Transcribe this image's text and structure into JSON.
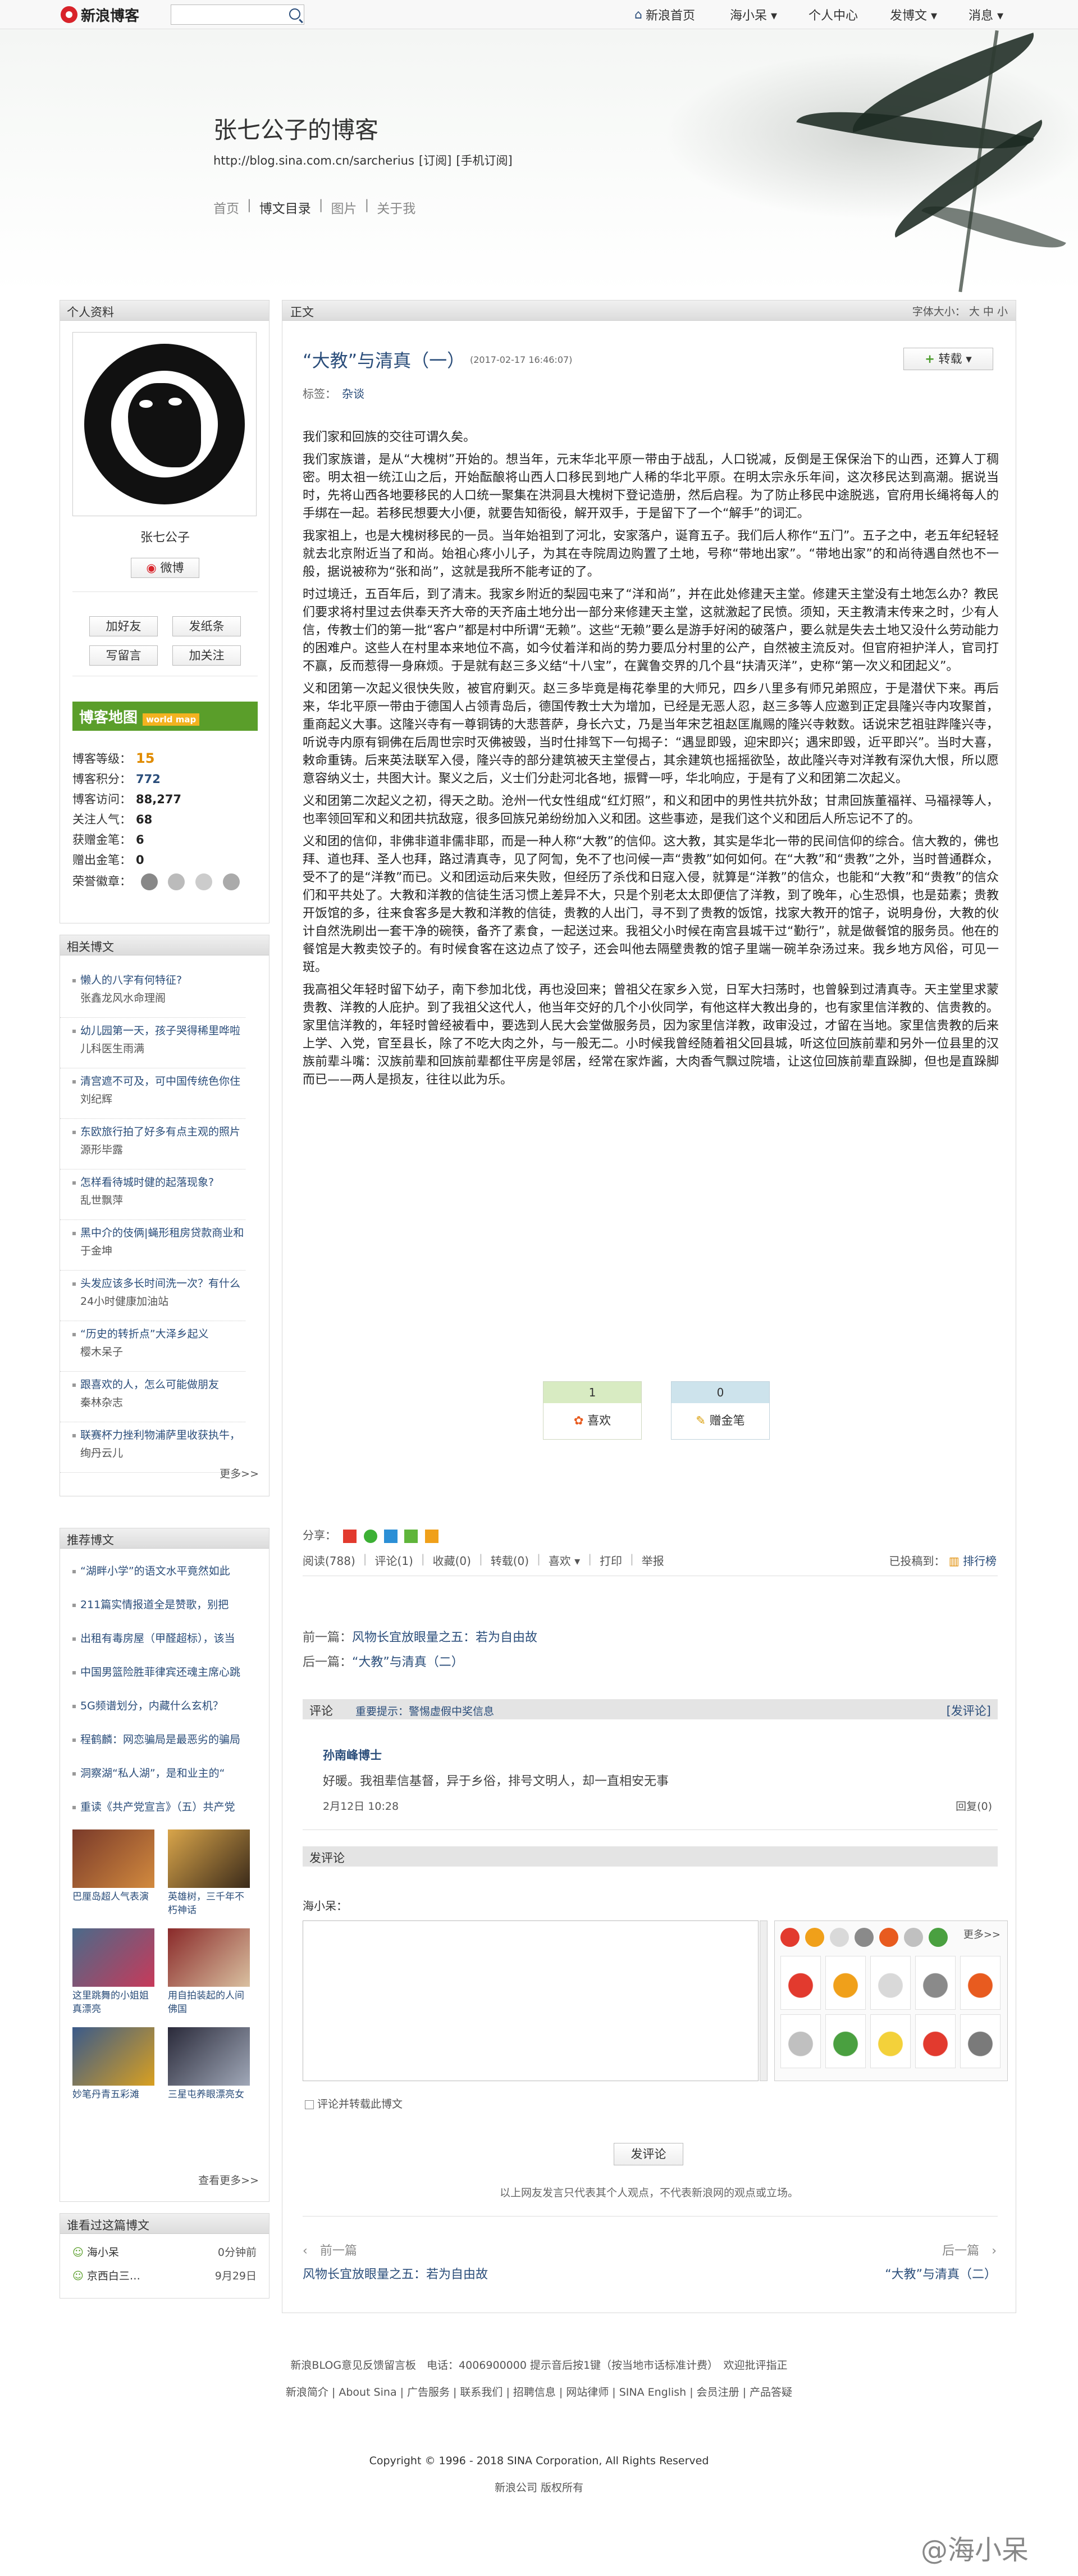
{
  "topbar": {
    "brand": "新浪博客",
    "search_placeholder": "",
    "nav": [
      "新浪首页",
      "海小呆 ▾",
      "个人中心",
      "发博文 ▾",
      "消息 ▾"
    ]
  },
  "header": {
    "title": "张七公子的博客",
    "url": "http://blog.sina.com.cn/sarcherius",
    "subscribe": "[订阅]",
    "mobile": "[手机订阅]",
    "nav": [
      "首页",
      "博文目录",
      "图片",
      "关于我"
    ]
  },
  "profile": {
    "heading": "个人资料",
    "name": "张七公子",
    "weibo": "微博",
    "buttons": [
      "加好友",
      "发纸条",
      "写留言",
      "加关注"
    ],
    "blogmap": "博客地图",
    "blogmap_sub": "world map",
    "stats": [
      {
        "label": "博客等级：",
        "value": "15"
      },
      {
        "label": "博客积分：",
        "value": "772"
      },
      {
        "label": "博客访问：",
        "value": "88,277"
      },
      {
        "label": "关注人气：",
        "value": "68"
      },
      {
        "label": "获赠金笔：",
        "value": "6"
      },
      {
        "label": "赠出金笔：",
        "value": "0"
      },
      {
        "label": "荣誉徽章：",
        "value": ""
      }
    ]
  },
  "related": {
    "heading": "相关博文",
    "more": "更多>>",
    "items": [
      {
        "t": "懒人的八字有何特征?",
        "s": "张鑫龙风水命理阁"
      },
      {
        "t": "幼儿园第一天，孩子哭得稀里哗啦",
        "s": "儿科医生雨满"
      },
      {
        "t": "清宫遮不可及，可中国传统色你住",
        "s": "刘纪辉"
      },
      {
        "t": "东欧旅行拍了好多有点主观的照片",
        "s": "源形毕露"
      },
      {
        "t": "怎样看待城时健的起落现象?",
        "s": "乱世飘萍"
      },
      {
        "t": "黑中介的伎俩|蝇形租房贷款商业和",
        "s": "于金坤"
      },
      {
        "t": "头发应该多长时间洗一次？有什么",
        "s": "24小时健康加油站"
      },
      {
        "t": "“历史的转折点”大泽乡起义",
        "s": "樱木呆子"
      },
      {
        "t": "跟喜欢的人，怎么可能做朋友",
        "s": "秦林杂志"
      },
      {
        "t": "联赛杯力挫利物浦萨里收获执牛，",
        "s": "绚丹云儿"
      }
    ]
  },
  "recommend": {
    "heading": "推荐博文",
    "more": "查看更多>>",
    "items": [
      "“湖畔小学”的语文水平竟然如此",
      "211篇实情报道全是赞歌，别把",
      "出租有毒房屋（甲醛超标），该当",
      "中国男篮险胜菲律宾还魂主席心跳",
      "5G频谱划分，内藏什么玄机？",
      "程鹤麟：网恋骗局是最恶劣的骗局",
      "洞察湖“私人湖”，是和业主的“",
      "重读《共产党宣言》（五）共产党"
    ],
    "pics": [
      {
        "c": "巴厘岛超人气表演"
      },
      {
        "c": "英雄树，三千年不朽神话"
      },
      {
        "c": "这里跳舞的小姐姐真漂亮"
      },
      {
        "c": "用自拍装起的人间佛国"
      },
      {
        "c": "妙笔丹青五彩滩"
      },
      {
        "c": "三星屯养眼漂亮女"
      }
    ]
  },
  "visitors": {
    "heading": "谁看过这篇博文",
    "rows": [
      {
        "name": "海小呆",
        "time": "0分钟前"
      },
      {
        "name": "京西白三…",
        "time": "9月29日"
      }
    ]
  },
  "main": {
    "heading": "正文",
    "fontsize": "字体大小：",
    "sizes": [
      "大",
      "中",
      "小"
    ],
    "title": "“大教”与清真（一）",
    "date": "(2017-02-17 16:46:07)",
    "share_btn": "转载 ▾",
    "tag_label": "标签：",
    "tag": "杂谈",
    "paragraphs": [
      "我们家和回族的交往可谓久矣。",
      "我们家族谱，是从“大槐树”开始的。想当年，元末华北平原一带由于战乱，人口锐减，反倒是王保保治下的山西，还算人丁稠密。明太祖一统江山之后，开始酝酿将山西人口移民到地广人稀的华北平原。在明太宗永乐年间，这次移民达到高潮。据说当时，先将山西各地要移民的人口统一聚集在洪洞县大槐树下登记造册，然后启程。为了防止移民中途脱逃，官府用长绳将每人的手绑在一起。若移民想要大小便，就要告知衙役，解开双手，于是留下了一个“解手”的词汇。",
      "我家祖上，也是大槐树移民的一员。当年始祖到了河北，安家落户，诞育五子。我们后人称作“五门”。五子之中，老五年纪轻轻就去北京附近当了和尚。始祖心疼小儿子，为其在寺院周边购置了土地，号称“带地出家”。“带地出家”的和尚待遇自然也不一般，据说被称为“张和尚”，这就是我所不能考证的了。",
      "时过境迁，五百年后，到了清末。我家乡附近的梨园屯来了“洋和尚”，并在此处修建天主堂。修建天主堂没有土地怎么办？教民们要求将村里过去供奉天齐大帝的天齐庙土地分出一部分来修建天主堂，这就激起了民愤。须知，天主教清末传来之时，少有人信，传教士们的第一批“客户”都是村中所谓“无赖”。这些“无赖”要么是游手好闲的破落户，要么就是失去土地又没什么劳动能力的困难户。这些人在村里本来地位不高，如今仗着洋和尚的势力要瓜分村里的公产，自然被主流反对。但官府袒护洋人，官司打不赢，反而惹得一身麻烦。于是就有赵三多义结“十八宝”，在冀鲁交界的几个县“扶清灭洋”，史称“第一次义和团起义”。",
      "义和团第一次起义很快失败，被官府剿灭。赵三多毕竟是梅花拳里的大师兄，四乡八里多有师兄弟照应，于是潜伏下来。再后来，华北平原一带由于德国人占领青岛后，德国传教士大为增加，已经是无恶人忍，赵三多等人应邀到正定县隆兴寺内攻聚首，重商起义大事。这隆兴寺有一尊铜铸的大悲菩萨，身长六丈，乃是当年宋艺祖赵匡胤赐的隆兴寺敕数。话说宋艺祖驻跸隆兴寺，听说寺内原有铜佛在后周世宗时灭佛被毁，当时仕排驾下一句揭子：“遇显即毁，迎宋即兴；遇宋即毁，近平即兴”。当时大喜，敕命重铸。后来英法联军入侵，隆兴寺的部分建筑被天主堂侵占，其余建筑也摇摇欲坠，故此隆兴寺对洋教有深仇大恨，所以愿意容纳义士，共图大计。聚义之后，义士们分赴河北各地，振臂一呼，华北响应，于是有了义和团第二次起义。",
      "义和团第二次起义之初，得天之助。沧州一代女性组成“红灯照”，和义和团中的男性共抗外敌；甘肃回族董福祥、马福禄等人，也率领回军和义和团共抗敌寇，很多回族兄弟纷纷加入义和团。这些事迹，是我们这个义和团后人所忘记不了的。",
      "义和团的信仰，非佛非道非儒非耶，而是一种人称“大教”的信仰。这大教，其实是华北一带的民间信仰的综合。信大教的，佛也拜、道也拜、圣人也拜，路过清真寺，见了阿訇，免不了也问候一声“贵教”如何如何。在“大教”和“贵教”之外，当时普通群众，受不了的是“洋教”而已。义和团运动后来失败，但经历了杀伐和日寇入侵，就算是“洋教”的信众，也能和“大教”和“贵教”的信众们和平共处了。大教和洋教的信徒生活习惯上差异不大，只是个别老太太即便信了洋教，到了晚年，心生恐惧，也是茹素；贵教开饭馆的多，往来食客多是大教和洋教的信徒，贵教的人出门，寻不到了贵教的饭馆，找家大教开的馆子，说明身份，大教的伙计自然洗刷出一套干净的碗筷，备齐了素食，一起送过来。我祖父小时候在南宫县城干过“勤行”，就是做餐馆的服务员。他在的餐馆是大教卖饺子的。有时候食客在这边点了饺子，还会叫他去隔壁贵教的馆子里端一碗羊杂汤过来。我乡地方风俗，可见一斑。",
      "我高祖父年轻时留下幼子，南下参加北伐，再也没回来；曾祖父在家乡入觉，日军大扫荡时，也曾躲到过清真寺。天主堂里求蒙贵教、洋教的人庇护。到了我祖父这代人，他当年交好的几个小伙同学，有他这样大教出身的，也有家里信洋教的、信贵教的。家里信洋教的，年轻时曾经被看中，要选到人民大会堂做服务员，因为家里信洋教，政审没过，才留在当地。家里信贵教的后来上学、入党，官至县长，除了不吃大肉之外，与一般无二。小时候我曾经随着祖父回县城，听这位回族前辈和另外一位县里的汉族前辈斗嘴：汉族前辈和回族前辈都住平房是邻居，经常在家炸酱，大肉香气飘过院墙，让这位回族前辈直跺脚，但也是直跺脚而已——两人是损友，往往以此为乐。"
    ],
    "like": {
      "count": "1",
      "label": "喜欢"
    },
    "pen": {
      "count": "0",
      "label": "赠金笔"
    },
    "share_label": "分享：",
    "meta": [
      "阅读(788)",
      "评论(1)",
      "收藏(0)",
      "转载(0)",
      "喜欢 ▾",
      "打印",
      "举报"
    ],
    "tagged": "已投稿到：",
    "rank": "排行榜",
    "prev_label": "前一篇：",
    "prev": "风物长宜放眼量之五：若为自由故",
    "next_label": "后一篇：",
    "next": "“大教”与清真（二）",
    "comment": {
      "heading": "评论",
      "notice": "重要提示：警惕虚假中奖信息",
      "post": "[发评论]",
      "author": "孙南峰博士",
      "text": "好暖。我祖辈信基督，异于乡俗，排号文明人，却一直相安无事",
      "date": "2月12日  10:28",
      "reply": "回复(0)"
    },
    "compose": {
      "heading": "发评论",
      "user": "海小呆：",
      "more": "更多>>",
      "checkbox": "评论并转载此博文",
      "submit": "发评论",
      "disclaimer": "以上网友发言只代表其个人观点，不代表新浪网的观点或立场。"
    },
    "pager": {
      "prev_label": "前一篇",
      "prev": "风物长宜放眼量之五：若为自由故",
      "next_label": "后一篇",
      "next": "“大教”与清真（二）"
    }
  },
  "footer": {
    "line1": "新浪BLOG意见反馈留言板　电话：4006900000 提示音后按1键（按当地市话标准计费）　欢迎批评指正",
    "links": [
      "新浪简介",
      "About Sina",
      "广告服务",
      "联系我们",
      "招聘信息",
      "网站律师",
      "SINA English",
      "会员注册",
      "产品答疑"
    ],
    "copyright": "Copyright © 1996 - 2018 SINA Corporation, All Rights Reserved",
    "owner": "新浪公司 版权所有",
    "watermark": "@海小呆"
  }
}
